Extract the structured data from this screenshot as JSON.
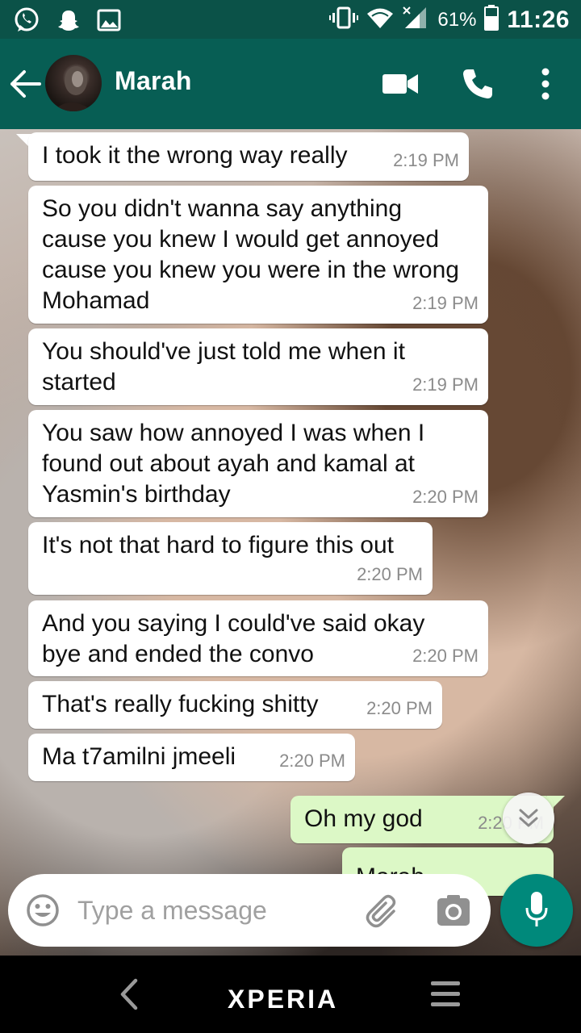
{
  "status_bar": {
    "battery_percent": "61%",
    "time": "11:26",
    "icons": [
      "whatsapp-icon",
      "snapchat-icon",
      "gallery-icon",
      "vibrate-icon",
      "wifi-icon",
      "signal-icon",
      "battery-icon"
    ]
  },
  "header": {
    "contact_name": "Marah",
    "icons": [
      "back-arrow-icon",
      "video-call-icon",
      "phone-icon",
      "more-vert-icon"
    ]
  },
  "messages": [
    {
      "direction": "in",
      "text": "I took it the wrong way really",
      "time": "2:19 PM"
    },
    {
      "direction": "in",
      "text": "So you didn't wanna say anything cause you knew I would get annoyed cause you knew you were in the wrong Mohamad",
      "time": "2:19 PM"
    },
    {
      "direction": "in",
      "text": "You should've just told me when it started",
      "time": "2:19 PM"
    },
    {
      "direction": "in",
      "text": "You saw how annoyed I was when I found out about ayah and kamal at Yasmin's birthday",
      "time": "2:20 PM"
    },
    {
      "direction": "in",
      "text": "It's not that hard to figure this out",
      "time": "2:20 PM"
    },
    {
      "direction": "in",
      "text": "And you saying I could've said okay bye and ended the convo",
      "time": "2:20 PM"
    },
    {
      "direction": "in",
      "text": "That's really fucking shitty",
      "time": "2:20 PM"
    },
    {
      "direction": "in",
      "text": "Ma t7amilni jmeeli",
      "time": "2:20 PM"
    },
    {
      "direction": "out",
      "text": "Oh my god",
      "time": "2:20 PM"
    },
    {
      "direction": "out",
      "text": "Marah",
      "time": ""
    }
  ],
  "composer": {
    "placeholder": "Type a message",
    "icons": [
      "emoji-icon",
      "attach-icon",
      "camera-icon",
      "mic-icon"
    ]
  },
  "nav_bar": {
    "brand": "XPERIA",
    "icons": [
      "nav-back-icon",
      "nav-menu-icon"
    ]
  },
  "colors": {
    "status_bar": "#0b5248",
    "header": "#075e54",
    "incoming_bubble": "#ffffff",
    "outgoing_bubble": "#dcf8c6",
    "mic_button": "#00897b"
  }
}
